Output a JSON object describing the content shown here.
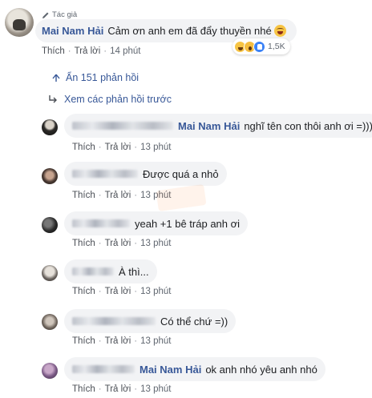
{
  "main_comment": {
    "author_badge": "Tác giả",
    "author": "Mai Nam Hải",
    "text": "Cảm ơn anh em đã đẩy thuyền nhé",
    "reaction_count": "1,5K",
    "actions": {
      "like": "Thích",
      "reply": "Trả lời",
      "time": "14 phút"
    }
  },
  "replies_toggle": "Ẩn 151 phản hồi",
  "previous_replies": "Xem các phản hồi trước",
  "replies": [
    {
      "mention": "Mai Nam Hải",
      "text": "nghĩ tên con thôi anh ơi =)))",
      "actions": {
        "like": "Thích",
        "reply": "Trả lời",
        "time": "13 phút"
      }
    },
    {
      "mention": "",
      "text": "Được quá a nhỏ",
      "actions": {
        "like": "Thích",
        "reply": "Trả lời",
        "time": "13 phút"
      }
    },
    {
      "mention": "",
      "text": "yeah +1 bê tráp anh ơi",
      "actions": {
        "like": "Thích",
        "reply": "Trả lời",
        "time": "13 phút"
      }
    },
    {
      "mention": "",
      "text": "À thì...",
      "actions": {
        "like": "Thích",
        "reply": "Trả lời",
        "time": "13 phút"
      }
    },
    {
      "mention": "",
      "text": "Có thể chứ =))",
      "actions": {
        "like": "Thích",
        "reply": "Trả lời",
        "time": "13 phút"
      }
    },
    {
      "mention": "Mai Nam Hải",
      "text": "ok anh nhó yêu anh nhó",
      "actions": {
        "like": "Thích",
        "reply": "Trả lời",
        "time": "13 phút"
      }
    }
  ],
  "colors": {
    "link": "#385898",
    "bubble": "#f2f3f5",
    "meta": "#606770"
  }
}
